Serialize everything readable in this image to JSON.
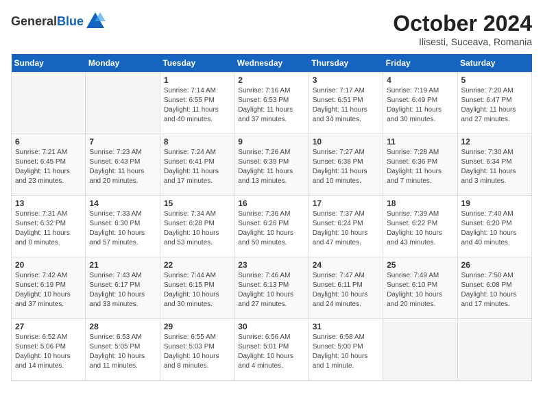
{
  "header": {
    "logo_general": "General",
    "logo_blue": "Blue",
    "title": "October 2024",
    "subtitle": "Ilisesti, Suceava, Romania"
  },
  "calendar": {
    "days_of_week": [
      "Sunday",
      "Monday",
      "Tuesday",
      "Wednesday",
      "Thursday",
      "Friday",
      "Saturday"
    ],
    "weeks": [
      [
        {
          "day": "",
          "detail": ""
        },
        {
          "day": "",
          "detail": ""
        },
        {
          "day": "1",
          "detail": "Sunrise: 7:14 AM\nSunset: 6:55 PM\nDaylight: 11 hours and 40 minutes."
        },
        {
          "day": "2",
          "detail": "Sunrise: 7:16 AM\nSunset: 6:53 PM\nDaylight: 11 hours and 37 minutes."
        },
        {
          "day": "3",
          "detail": "Sunrise: 7:17 AM\nSunset: 6:51 PM\nDaylight: 11 hours and 34 minutes."
        },
        {
          "day": "4",
          "detail": "Sunrise: 7:19 AM\nSunset: 6:49 PM\nDaylight: 11 hours and 30 minutes."
        },
        {
          "day": "5",
          "detail": "Sunrise: 7:20 AM\nSunset: 6:47 PM\nDaylight: 11 hours and 27 minutes."
        }
      ],
      [
        {
          "day": "6",
          "detail": "Sunrise: 7:21 AM\nSunset: 6:45 PM\nDaylight: 11 hours and 23 minutes."
        },
        {
          "day": "7",
          "detail": "Sunrise: 7:23 AM\nSunset: 6:43 PM\nDaylight: 11 hours and 20 minutes."
        },
        {
          "day": "8",
          "detail": "Sunrise: 7:24 AM\nSunset: 6:41 PM\nDaylight: 11 hours and 17 minutes."
        },
        {
          "day": "9",
          "detail": "Sunrise: 7:26 AM\nSunset: 6:39 PM\nDaylight: 11 hours and 13 minutes."
        },
        {
          "day": "10",
          "detail": "Sunrise: 7:27 AM\nSunset: 6:38 PM\nDaylight: 11 hours and 10 minutes."
        },
        {
          "day": "11",
          "detail": "Sunrise: 7:28 AM\nSunset: 6:36 PM\nDaylight: 11 hours and 7 minutes."
        },
        {
          "day": "12",
          "detail": "Sunrise: 7:30 AM\nSunset: 6:34 PM\nDaylight: 11 hours and 3 minutes."
        }
      ],
      [
        {
          "day": "13",
          "detail": "Sunrise: 7:31 AM\nSunset: 6:32 PM\nDaylight: 11 hours and 0 minutes."
        },
        {
          "day": "14",
          "detail": "Sunrise: 7:33 AM\nSunset: 6:30 PM\nDaylight: 10 hours and 57 minutes."
        },
        {
          "day": "15",
          "detail": "Sunrise: 7:34 AM\nSunset: 6:28 PM\nDaylight: 10 hours and 53 minutes."
        },
        {
          "day": "16",
          "detail": "Sunrise: 7:36 AM\nSunset: 6:26 PM\nDaylight: 10 hours and 50 minutes."
        },
        {
          "day": "17",
          "detail": "Sunrise: 7:37 AM\nSunset: 6:24 PM\nDaylight: 10 hours and 47 minutes."
        },
        {
          "day": "18",
          "detail": "Sunrise: 7:39 AM\nSunset: 6:22 PM\nDaylight: 10 hours and 43 minutes."
        },
        {
          "day": "19",
          "detail": "Sunrise: 7:40 AM\nSunset: 6:20 PM\nDaylight: 10 hours and 40 minutes."
        }
      ],
      [
        {
          "day": "20",
          "detail": "Sunrise: 7:42 AM\nSunset: 6:19 PM\nDaylight: 10 hours and 37 minutes."
        },
        {
          "day": "21",
          "detail": "Sunrise: 7:43 AM\nSunset: 6:17 PM\nDaylight: 10 hours and 33 minutes."
        },
        {
          "day": "22",
          "detail": "Sunrise: 7:44 AM\nSunset: 6:15 PM\nDaylight: 10 hours and 30 minutes."
        },
        {
          "day": "23",
          "detail": "Sunrise: 7:46 AM\nSunset: 6:13 PM\nDaylight: 10 hours and 27 minutes."
        },
        {
          "day": "24",
          "detail": "Sunrise: 7:47 AM\nSunset: 6:11 PM\nDaylight: 10 hours and 24 minutes."
        },
        {
          "day": "25",
          "detail": "Sunrise: 7:49 AM\nSunset: 6:10 PM\nDaylight: 10 hours and 20 minutes."
        },
        {
          "day": "26",
          "detail": "Sunrise: 7:50 AM\nSunset: 6:08 PM\nDaylight: 10 hours and 17 minutes."
        }
      ],
      [
        {
          "day": "27",
          "detail": "Sunrise: 6:52 AM\nSunset: 5:06 PM\nDaylight: 10 hours and 14 minutes."
        },
        {
          "day": "28",
          "detail": "Sunrise: 6:53 AM\nSunset: 5:05 PM\nDaylight: 10 hours and 11 minutes."
        },
        {
          "day": "29",
          "detail": "Sunrise: 6:55 AM\nSunset: 5:03 PM\nDaylight: 10 hours and 8 minutes."
        },
        {
          "day": "30",
          "detail": "Sunrise: 6:56 AM\nSunset: 5:01 PM\nDaylight: 10 hours and 4 minutes."
        },
        {
          "day": "31",
          "detail": "Sunrise: 6:58 AM\nSunset: 5:00 PM\nDaylight: 10 hours and 1 minute."
        },
        {
          "day": "",
          "detail": ""
        },
        {
          "day": "",
          "detail": ""
        }
      ]
    ]
  }
}
